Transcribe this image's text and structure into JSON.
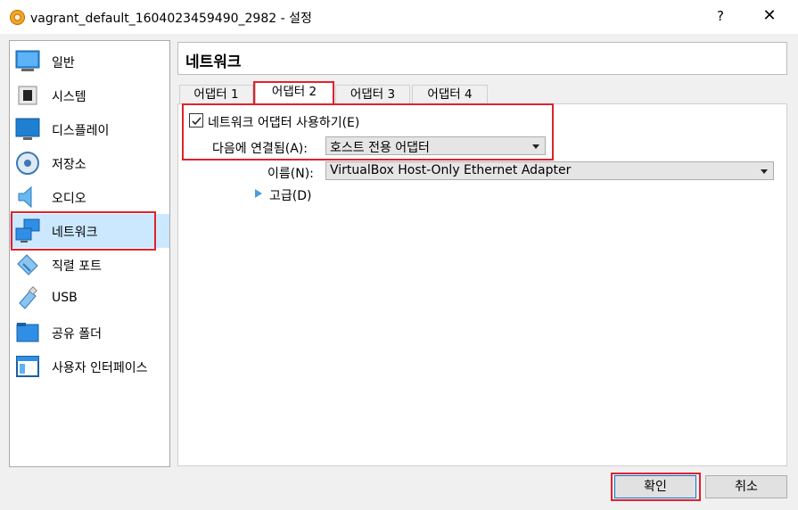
{
  "window": {
    "title": "vagrant_default_1604023459490_2982 - 설정",
    "help_label": "?",
    "close_label": "✕"
  },
  "sidebar": {
    "items": [
      {
        "label": "일반",
        "icon": "monitor-icon"
      },
      {
        "label": "시스템",
        "icon": "chip-icon"
      },
      {
        "label": "디스플레이",
        "icon": "display-icon"
      },
      {
        "label": "저장소",
        "icon": "storage-disk-icon"
      },
      {
        "label": "오디오",
        "icon": "speaker-icon"
      },
      {
        "label": "네트워크",
        "icon": "network-icon",
        "selected": true
      },
      {
        "label": "직렬 포트",
        "icon": "serial-port-icon"
      },
      {
        "label": "USB",
        "icon": "usb-icon"
      },
      {
        "label": "공유 폴더",
        "icon": "shared-folder-icon"
      },
      {
        "label": "사용자 인터페이스",
        "icon": "user-interface-icon"
      }
    ]
  },
  "section": {
    "title": "네트워크"
  },
  "tabs": [
    {
      "label": "어댑터 1"
    },
    {
      "label": "어댑터 2",
      "active": true
    },
    {
      "label": "어댑터 3"
    },
    {
      "label": "어댑터 4"
    }
  ],
  "adapter": {
    "enable_label": "네트워크 어댑터 사용하기(E)",
    "enabled": true,
    "attached_label": "다음에 연결됨(A):",
    "attached_value": "호스트 전용 어댑터",
    "name_label": "이름(N):",
    "name_value": "VirtualBox Host-Only Ethernet Adapter",
    "advanced_label": "고급(D)"
  },
  "buttons": {
    "ok": "확인",
    "cancel": "취소"
  },
  "colors": {
    "highlight": "#e0222e",
    "selected_bg": "#cce8ff",
    "accent": "#0078d7"
  }
}
